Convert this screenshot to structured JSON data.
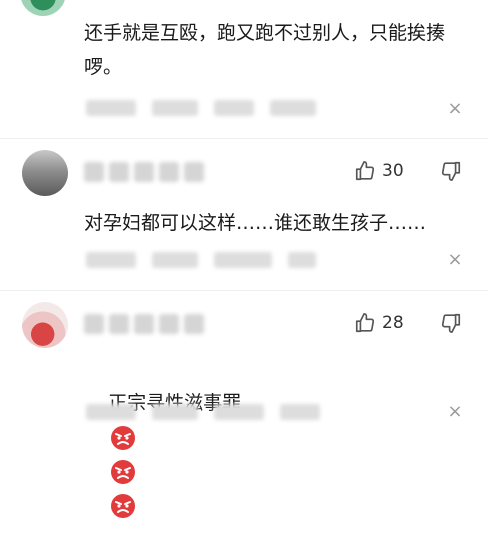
{
  "comments": [
    {
      "text": "还手就是互殴，跑又跑不过别人，只能挨揍啰。"
    },
    {
      "like_count": "30",
      "text": "对孕妇都可以这样……谁还敢生孩子……"
    },
    {
      "like_count": "28",
      "text": "正宗寻性滋事罪",
      "emoji_count": 3
    }
  ],
  "icons": {
    "like": "thumbs-up-icon",
    "dislike": "thumbs-down-icon",
    "close": "close-icon",
    "emoji": "angry-face-emoji"
  },
  "colors": {
    "text": "#1a1a1a",
    "icon": "#555555",
    "emoji_red": "#e23b3b"
  }
}
